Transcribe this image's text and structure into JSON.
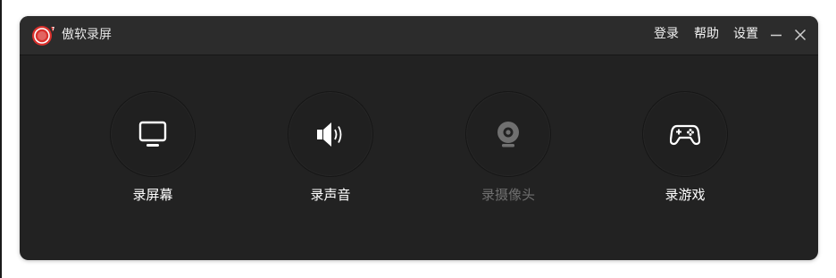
{
  "app": {
    "title": "傲软录屏",
    "logo_icon": "record-logo-icon"
  },
  "titlebar": {
    "menu": {
      "login": "登录",
      "help": "帮助",
      "settings": "设置"
    },
    "window_controls": [
      "minimize-icon",
      "close-icon"
    ]
  },
  "modes": [
    {
      "label": "录屏幕",
      "icon": "monitor-icon",
      "enabled": true
    },
    {
      "label": "录声音",
      "icon": "speaker-icon",
      "enabled": true
    },
    {
      "label": "录摄像头",
      "icon": "webcam-icon",
      "enabled": false
    },
    {
      "label": "录游戏",
      "icon": "gamepad-icon",
      "enabled": true
    }
  ],
  "colors": {
    "background": "#222222",
    "titlebar": "#2c2c2c",
    "accent": "#e8322e",
    "text": "#ffffff",
    "disabled_text": "#6f6f6f"
  }
}
